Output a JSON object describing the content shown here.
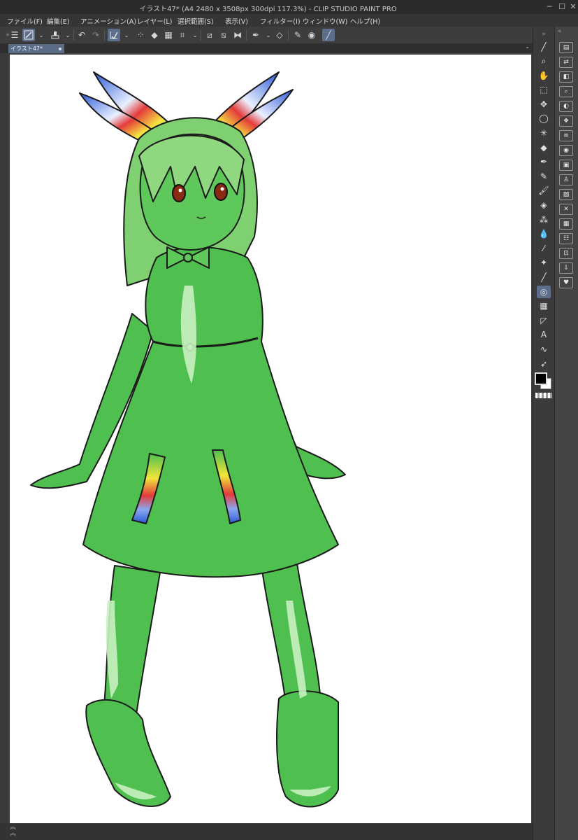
{
  "window": {
    "title": "イラスト47* (A4 2480 x 3508px 300dpi 117.3%)  - CLIP STUDIO PAINT PRO",
    "minimize": "─",
    "maximize": "☐",
    "close": "✕"
  },
  "menu": [
    "ファイル(F)",
    "編集(E)",
    "アニメーション(A)",
    "レイヤー(L)",
    "選択範囲(S)",
    "表示(V)",
    "フィルター(I)",
    "ウィンドウ(W)",
    "ヘルプ(H)"
  ],
  "toolbar": {
    "menu_icon": "☰",
    "undo_icon": "↶",
    "redo_icon": "↷"
  },
  "document": {
    "tab_label": "イラスト47*",
    "tab_menu": "⌄"
  },
  "tools": [
    {
      "name": "zoom-icon",
      "glyph": "⌕"
    },
    {
      "name": "hand-icon",
      "glyph": "✋"
    },
    {
      "name": "object-select-icon",
      "glyph": "⬚"
    },
    {
      "name": "move-icon",
      "glyph": "✥"
    },
    {
      "name": "lasso-icon",
      "glyph": "◯"
    },
    {
      "name": "magic-wand-icon",
      "glyph": "✳"
    },
    {
      "name": "eraser-icon",
      "glyph": "◆"
    },
    {
      "name": "pen-icon",
      "glyph": "✒"
    },
    {
      "name": "pencil-icon",
      "glyph": "✎"
    },
    {
      "name": "brush-icon",
      "glyph": "🖌"
    },
    {
      "name": "fill-icon",
      "glyph": "◈"
    },
    {
      "name": "airbrush-icon",
      "glyph": "⁂"
    },
    {
      "name": "blend-icon",
      "glyph": "💧"
    },
    {
      "name": "eyedropper-icon",
      "glyph": "⁄"
    },
    {
      "name": "decoration-icon",
      "glyph": "✦"
    },
    {
      "name": "line-icon",
      "glyph": "╱"
    },
    {
      "name": "gradient-icon",
      "glyph": "◎"
    },
    {
      "name": "fill-bucket-icon",
      "glyph": "▦"
    },
    {
      "name": "ruler-icon",
      "glyph": "◸"
    },
    {
      "name": "text-icon",
      "glyph": "A"
    },
    {
      "name": "balloon-icon",
      "glyph": "∿"
    },
    {
      "name": "correct-line-icon",
      "glyph": "➶"
    }
  ],
  "active_tool_index": 16,
  "right_panel": [
    {
      "name": "sub-tool-icon",
      "glyph": "▤"
    },
    {
      "name": "animation-icon",
      "glyph": "⇄"
    },
    {
      "name": "layer-property-icon",
      "glyph": "◧"
    },
    {
      "name": "navigator-icon",
      "glyph": "⌕"
    },
    {
      "name": "color-mix-icon",
      "glyph": "◐"
    },
    {
      "name": "material-icon",
      "glyph": "❖"
    },
    {
      "name": "layers-icon",
      "glyph": "≋"
    },
    {
      "name": "camera-icon",
      "glyph": "◉"
    },
    {
      "name": "folder-image-icon",
      "glyph": "▣"
    },
    {
      "name": "figure-icon",
      "glyph": "♙"
    },
    {
      "name": "picture-icon",
      "glyph": "▨"
    },
    {
      "name": "close-box-icon",
      "glyph": "✕"
    },
    {
      "name": "grid-icon",
      "glyph": "▦"
    },
    {
      "name": "list-icon",
      "glyph": "☷"
    },
    {
      "name": "save-icon",
      "glyph": "⊡"
    },
    {
      "name": "download-icon",
      "glyph": "⇩"
    },
    {
      "name": "favorite-icon",
      "glyph": "♥"
    }
  ],
  "colors": {
    "foreground": "#000000",
    "background": "#ffffff",
    "accent": "#5d6e8c",
    "figure_green": "#4fc04f",
    "highlight_green": "#a8e6a0"
  }
}
